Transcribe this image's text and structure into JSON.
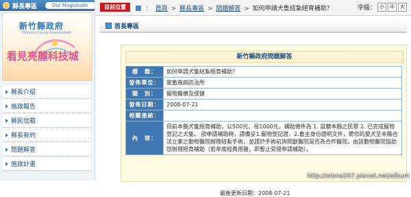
{
  "sidebar": {
    "header_title": "縣長專區",
    "header_sub": "Our Magistrate",
    "banner_county": "新竹縣政府",
    "banner_en": "Hsinchu County Government",
    "banner_slogan": "看見亮麗科技城",
    "items": [
      {
        "label": "縣長介紹"
      },
      {
        "label": "施政報告"
      },
      {
        "label": "縣民信箱"
      },
      {
        "label": "縣長有約"
      },
      {
        "label": "問題解答"
      },
      {
        "label": "施政計畫"
      }
    ]
  },
  "topbar": {
    "location_label": "目前位置",
    "breadcrumb": [
      "首頁",
      "縣長專區",
      "問題解答"
    ],
    "current": "如何申請犬隻結紮絕育補助？",
    "font_label": "字級：",
    "font_sizes": [
      "小",
      "中",
      "大"
    ]
  },
  "main": {
    "section_title": "首長專區",
    "panel_title": "新竹縣政府問題解答",
    "rows": [
      {
        "key": "標　題：",
        "value": "如何申請犬隻結紮絕育補助？"
      },
      {
        "key": "發佈單位：",
        "value": "家畜疾病防治所"
      },
      {
        "key": "類　別：",
        "value": "寵物醫療及保健"
      },
      {
        "key": "發佈日期：",
        "value": "2008-07-21"
      },
      {
        "key": "相關連結：",
        "value": ""
      },
      {
        "key": "內　容：",
        "value": "目前本縣犬隻絕育補助，公500元、母1000元，補助條件為 1. 設籍本縣之民眾 2. 已完成寵物登記之犬隻。 欲申請補助時，請備妥1.寵物登記證，2.畜主身份證明文件，帶您的愛犬至本縣合法立案之動物醫院辦理結紮手術，並請於手術前詢問獸醫院是否為合作醫院，由該動物醫院協助您辦理絕育補助（若年度經費用罄，即暫止受理申請補助）。"
      }
    ],
    "updated": "最後更新日期：2008-07-21"
  },
  "watermark": "http://elena207.pixnet.net/album"
}
